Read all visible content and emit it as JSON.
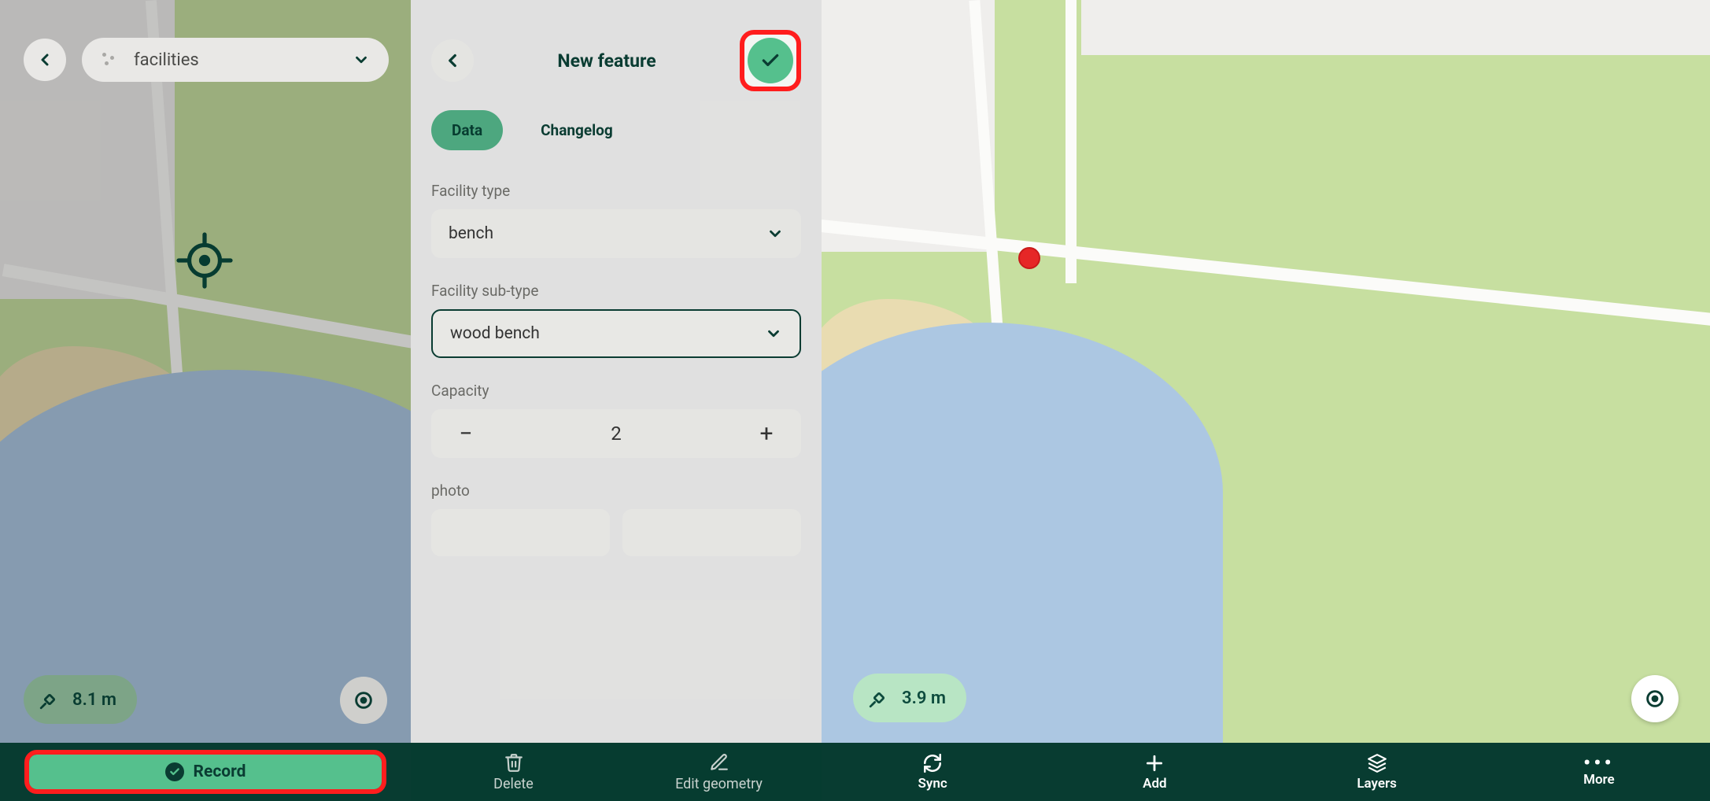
{
  "panel1": {
    "layer_label": "facilities",
    "distance": "8.1 m",
    "record_label": "Record"
  },
  "panel2": {
    "title": "New feature",
    "tabs": {
      "data": "Data",
      "changelog": "Changelog"
    },
    "fields": {
      "facility_type_label": "Facility type",
      "facility_type_value": "bench",
      "facility_subtype_label": "Facility sub-type",
      "facility_subtype_value": "wood bench",
      "capacity_label": "Capacity",
      "capacity_value": "2",
      "photo_label": "photo"
    },
    "actions": {
      "delete": "Delete",
      "edit_geometry": "Edit geometry"
    }
  },
  "panel3": {
    "distance": "3.9 m",
    "nav": {
      "sync": "Sync",
      "add": "Add",
      "layers": "Layers",
      "more": "More"
    }
  }
}
